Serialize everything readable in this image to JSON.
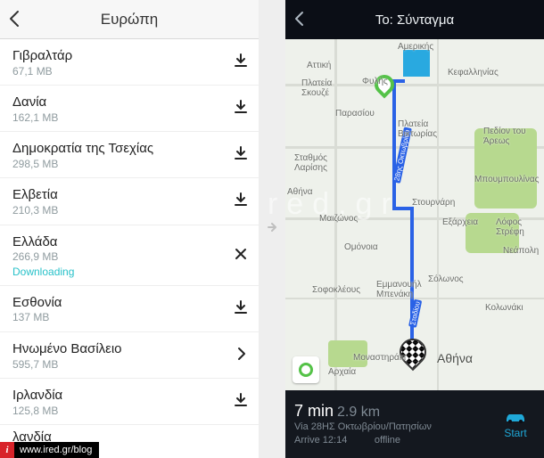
{
  "left": {
    "title": "Ευρώπη",
    "items": [
      {
        "name": "Γιβραλτάρ",
        "size": "67,1 MB",
        "action": "download"
      },
      {
        "name": "Δανία",
        "size": "162,1 MB",
        "action": "download"
      },
      {
        "name": "Δημοκρατία της Τσεχίας",
        "size": "298,5 MB",
        "action": "download"
      },
      {
        "name": "Ελβετία",
        "size": "210,3 MB",
        "action": "download"
      },
      {
        "name": "Ελλάδα",
        "size": "266,9 MB",
        "action": "cancel",
        "status": "Downloading"
      },
      {
        "name": "Εσθονία",
        "size": "137 MB",
        "action": "download"
      },
      {
        "name": "Ηνωμένο Βασίλειο",
        "size": "595,7 MB",
        "action": "chevron"
      },
      {
        "name": "Ιρλανδία",
        "size": "125,8 MB",
        "action": "download"
      },
      {
        "name": "λανδία",
        "size": "",
        "action": ""
      }
    ]
  },
  "right": {
    "title": "Το: Σύνταγμα",
    "map_labels": {
      "amerikis": "Αμερικής",
      "attiki": "Αττική",
      "plskouze": "Πλατεία\nΣκουζέ",
      "filis": "Φυλής",
      "parasiou": "Παρασίου",
      "kefallinias": "Κεφαλληνίας",
      "plviktorias": "Πλατεία\nΒικτωρίας",
      "stlarisis": "Σταθμός\nΛαρίσης",
      "athina": "Αθήνα",
      "maizonos": "Μαιζώνος",
      "omonoia": "Ομόνοια",
      "sofokleous": "Σοφοκλέους",
      "emkiou": "Εμμανουήλ\nΜπενάκη",
      "solonos": "Σόλωνος",
      "kolonaki": "Κολωνάκι",
      "monastiraki": "Μοναστηράκι",
      "plaka": "Αρχαία",
      "athens": "Αθήνα",
      "stournari": "Στουρνάρη",
      "exarcheia": "Εξάρχεια",
      "neapoli": "Νεάπολη",
      "pedion": "Πεδίον του\nΆρεως",
      "lofos": "Λόφος\nΣτρέφη",
      "mpo": "Μπουμπουλίνας",
      "road_28": "28ης Οκτωβρίου",
      "road_stadiou": "Σταδίου"
    },
    "footer": {
      "time": "7 min",
      "distance": "2.9 km",
      "via": "Via 28ΗΣ Οκτωβρίου/Πατησίων",
      "arrive": "Arrive 12:14",
      "start": "Start",
      "offline": "offline"
    }
  },
  "watermark": "www.ired.gr",
  "credit": "www.ired.gr/blog"
}
